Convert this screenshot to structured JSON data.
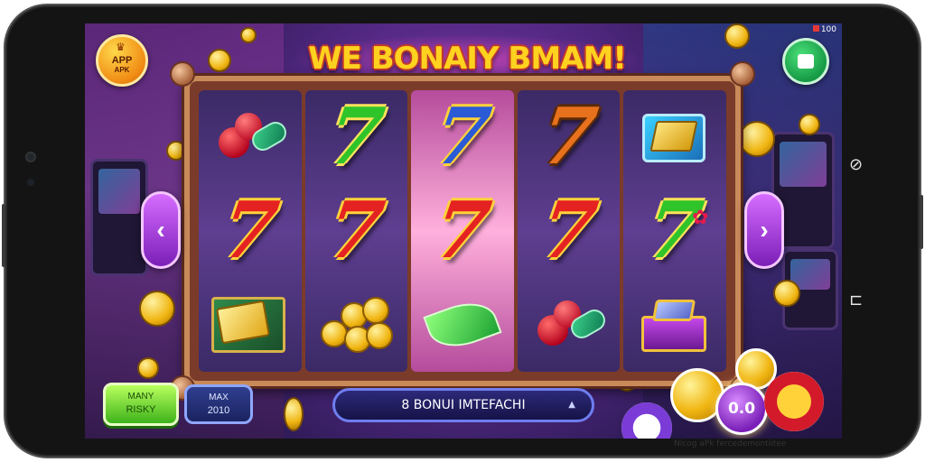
{
  "game": {
    "title": "WE BONAIY BMAM!",
    "app_badge": {
      "line1": "APP",
      "line2": "APK"
    },
    "status_tag": "100"
  },
  "reels": [
    {
      "symbols": [
        "cherry-bill-icon",
        "seven-red",
        "gold-bar-icon"
      ]
    },
    {
      "symbols": [
        "seven-green",
        "seven-red",
        "coins-icon"
      ]
    },
    {
      "symbols": [
        "seven-blue",
        "seven-red",
        "leaf-gem-icon"
      ]
    },
    {
      "symbols": [
        "seven-orange",
        "seven-red",
        "cherry-bill-icon"
      ]
    },
    {
      "symbols": [
        "gold-box-icon",
        "seven-green",
        "chest-icon"
      ]
    }
  ],
  "controls": {
    "left_arrow": "‹",
    "right_arrow": "›",
    "green_button": {
      "line1": "MANY",
      "line2": "RISKY"
    },
    "bet_box": {
      "line1": "MAX",
      "line2": "2010"
    },
    "info_bar": "8 BONUI IMTEFACHI",
    "spin_value": "0.0"
  },
  "watermark": "Nicog aPk fercedemontiitee",
  "colors": {
    "frame": "#c98a5a",
    "title": "#ffd21f",
    "accent_purple": "#7a1fb8",
    "accent_green": "#3eb31b"
  }
}
